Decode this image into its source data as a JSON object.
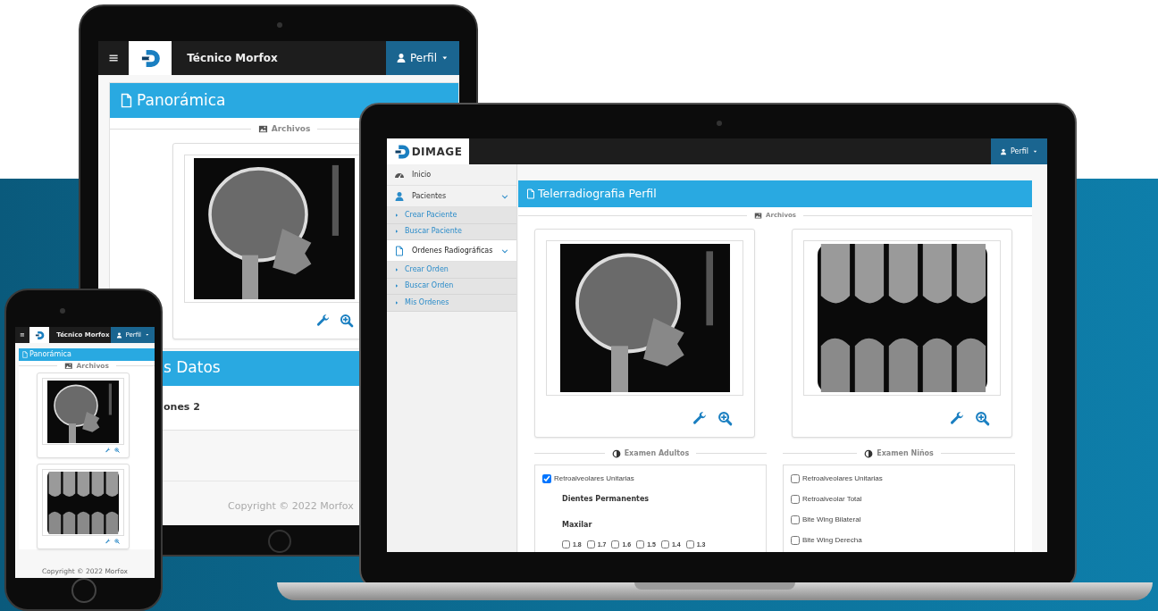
{
  "tablet": {
    "user": "Técnico Morfox",
    "profile_button": "Perfil",
    "panel_title": "Panorámica",
    "files_label": "Archivos",
    "images": [
      {
        "kind": "skull"
      }
    ],
    "section_title": "s Datos",
    "section_text": "ones 2",
    "footer": "Copyright © 2022 Morfox"
  },
  "phone": {
    "user": "Técnico Morfox",
    "profile_button": "Perfil",
    "panel_title": "Panorámica",
    "files_label": "Archivos",
    "images": [
      {
        "kind": "skull"
      },
      {
        "kind": "teeth"
      }
    ],
    "footer": "Copyright © 2022 Morfox"
  },
  "laptop": {
    "brand": "DIMAGE",
    "profile_button": "Perfil",
    "sidebar": [
      {
        "label": "Inicio",
        "kind": "dashboard",
        "selected": false
      },
      {
        "label": "Pacientes",
        "kind": "user",
        "selected": false,
        "expanded": true,
        "children": [
          {
            "label": "Crear Paciente"
          },
          {
            "label": "Buscar Paciente"
          }
        ]
      },
      {
        "label": "Ordenes Radiográficas",
        "kind": "file",
        "selected": true,
        "expanded": true,
        "children": [
          {
            "label": "Crear Orden"
          },
          {
            "label": "Buscar Orden"
          },
          {
            "label": "Mis Ordenes"
          }
        ]
      }
    ],
    "panel_title": "Telerradiografia Perfil",
    "files_label": "Archivos",
    "images": [
      {
        "kind": "skull"
      },
      {
        "kind": "teeth"
      }
    ],
    "exams": [
      {
        "title": "Examen Adultos",
        "options": [
          {
            "label": "Retroalveolares Unitarias",
            "checked": true
          }
        ],
        "subtitle": "Dientes Permanentes",
        "group": "Maxilar",
        "teeth": [
          {
            "label": "1.8",
            "checked": false
          },
          {
            "label": "1.7",
            "checked": false
          },
          {
            "label": "1.6",
            "checked": false
          },
          {
            "label": "1.5",
            "checked": false
          },
          {
            "label": "1.4",
            "checked": false
          },
          {
            "label": "1.3",
            "checked": false
          }
        ]
      },
      {
        "title": "Examen Niños",
        "options": [
          {
            "label": "Retroalveolares Unitarias",
            "checked": false
          },
          {
            "label": "Retroalveolar Total",
            "checked": false
          },
          {
            "label": "Bite Wing Bilateral",
            "checked": false
          },
          {
            "label": "Bite Wing Derecha",
            "checked": false
          }
        ]
      }
    ]
  }
}
